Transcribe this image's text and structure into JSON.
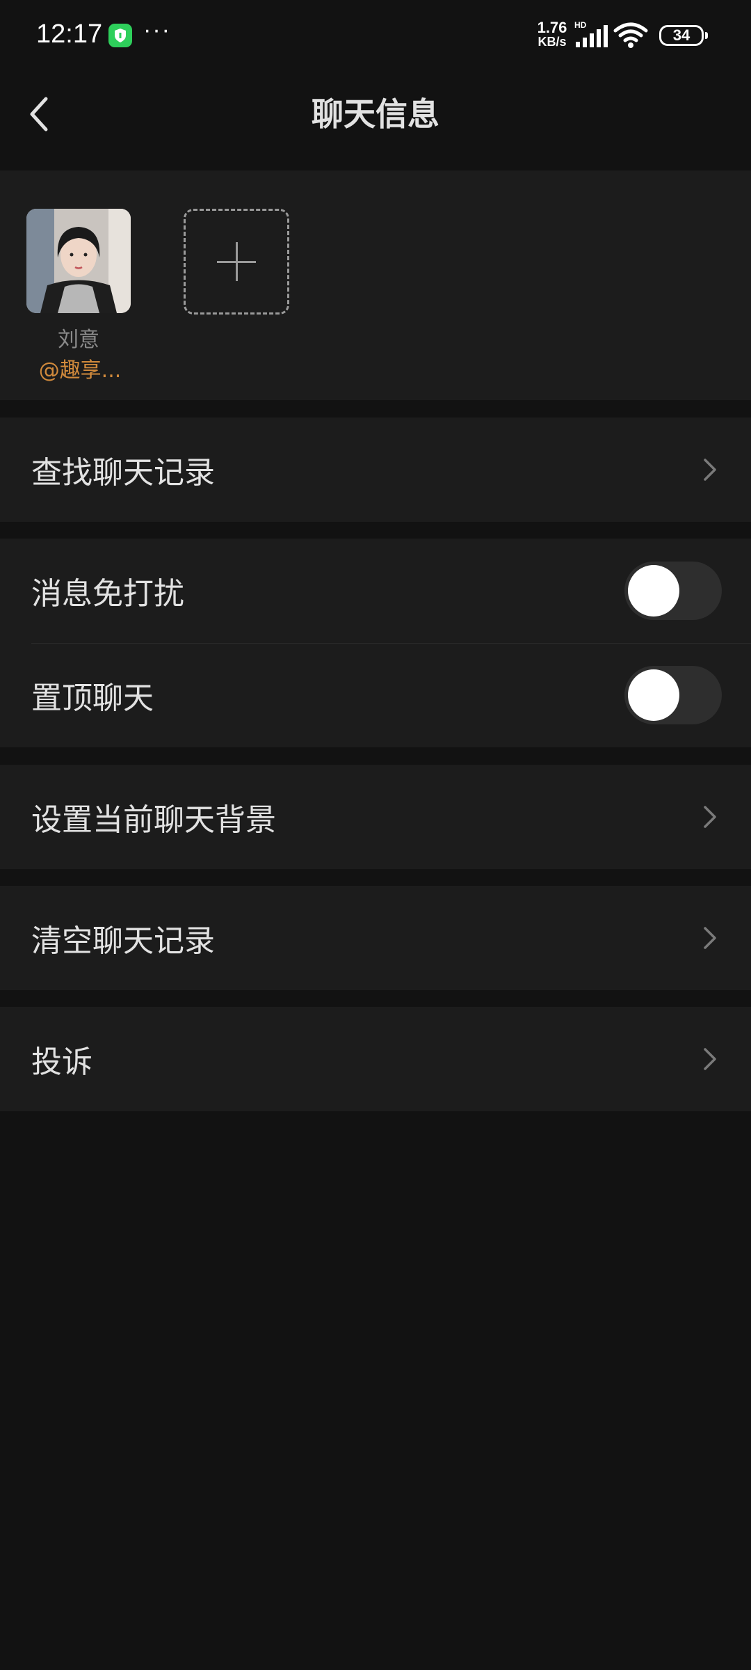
{
  "status_bar": {
    "time": "12:17",
    "dots": "···",
    "net_speed_value": "1.76",
    "net_speed_unit": "KB/s",
    "network_type": "HD",
    "battery": "34",
    "icons": [
      "shield-icon",
      "signal-icon",
      "wifi-icon",
      "battery-icon"
    ],
    "shield_color": "#2ecf5b"
  },
  "header": {
    "title": "聊天信息",
    "back_icon": "chevron-left-icon"
  },
  "members": {
    "items": [
      {
        "name": "刘意",
        "tag": "@趣享..."
      }
    ],
    "add_icon": "plus-icon",
    "tag_color": "#d18a3c"
  },
  "menu": {
    "search_history": "查找聊天记录",
    "mute": {
      "label": "消息免打扰",
      "enabled": false
    },
    "pin": {
      "label": "置顶聊天",
      "enabled": false
    },
    "set_background": "设置当前聊天背景",
    "clear_history": "清空聊天记录",
    "report": "投诉"
  }
}
